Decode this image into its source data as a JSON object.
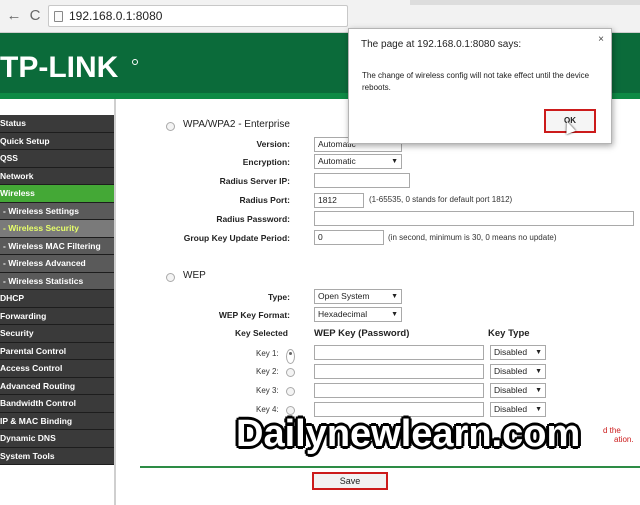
{
  "browser": {
    "back_glyph": "←",
    "reload_glyph": "C",
    "url": "192.168.0.1:8080"
  },
  "brand": {
    "logo_text": "TP-LINK"
  },
  "sidebar": {
    "items": [
      {
        "label": "Status"
      },
      {
        "label": "Quick Setup"
      },
      {
        "label": "QSS"
      },
      {
        "label": "Network"
      },
      {
        "label": "Wireless"
      },
      {
        "label": "- Wireless Settings"
      },
      {
        "label": "- Wireless Security"
      },
      {
        "label": "- Wireless MAC Filtering"
      },
      {
        "label": "- Wireless Advanced"
      },
      {
        "label": "- Wireless Statistics"
      },
      {
        "label": "DHCP"
      },
      {
        "label": "Forwarding"
      },
      {
        "label": "Security"
      },
      {
        "label": "Parental Control"
      },
      {
        "label": "Access Control"
      },
      {
        "label": "Advanced Routing"
      },
      {
        "label": "Bandwidth Control"
      },
      {
        "label": "IP & MAC Binding"
      },
      {
        "label": "Dynamic DNS"
      },
      {
        "label": "System Tools"
      }
    ]
  },
  "enterprise": {
    "heading": "WPA/WPA2 - Enterprise",
    "version_label": "Version:",
    "version_value": "Automatic",
    "encryption_label": "Encryption:",
    "encryption_value": "Automatic",
    "radius_ip_label": "Radius Server IP:",
    "radius_ip_value": "",
    "radius_port_label": "Radius Port:",
    "radius_port_value": "1812",
    "radius_port_hint": "(1-65535, 0 stands for default port 1812)",
    "radius_password_label": "Radius Password:",
    "radius_password_value": "",
    "group_key_label": "Group Key Update Period:",
    "group_key_value": "0",
    "group_key_hint": "(in second, minimum is 30, 0 means no update)"
  },
  "wep": {
    "heading": "WEP",
    "type_label": "Type:",
    "type_value": "Open System",
    "format_label": "WEP Key Format:",
    "format_value": "Hexadecimal",
    "col_key_selected": "Key Selected",
    "col_wep_key": "WEP Key (Password)",
    "col_key_type": "Key Type",
    "keys": [
      {
        "label": "Key 1:",
        "value": "",
        "type": "Disabled"
      },
      {
        "label": "Key 2:",
        "value": "",
        "type": "Disabled"
      },
      {
        "label": "Key 3:",
        "value": "",
        "type": "Disabled"
      },
      {
        "label": "Key 4:",
        "value": "",
        "type": "Disabled"
      }
    ]
  },
  "footer": {
    "save_label": "Save",
    "partial_red_1": "d the",
    "partial_red_2": "ation."
  },
  "dialog": {
    "title": "The page at 192.168.0.1:8080 says:",
    "message": "The change of wireless config will not take effect until the device reboots.",
    "ok_label": "OK",
    "close_glyph": "×"
  },
  "watermark": "Dailynewlearn.com",
  "colors": {
    "header_green": "#0b6b3a",
    "menu_active": "#44a836",
    "highlight_red": "#cc1b1b"
  }
}
